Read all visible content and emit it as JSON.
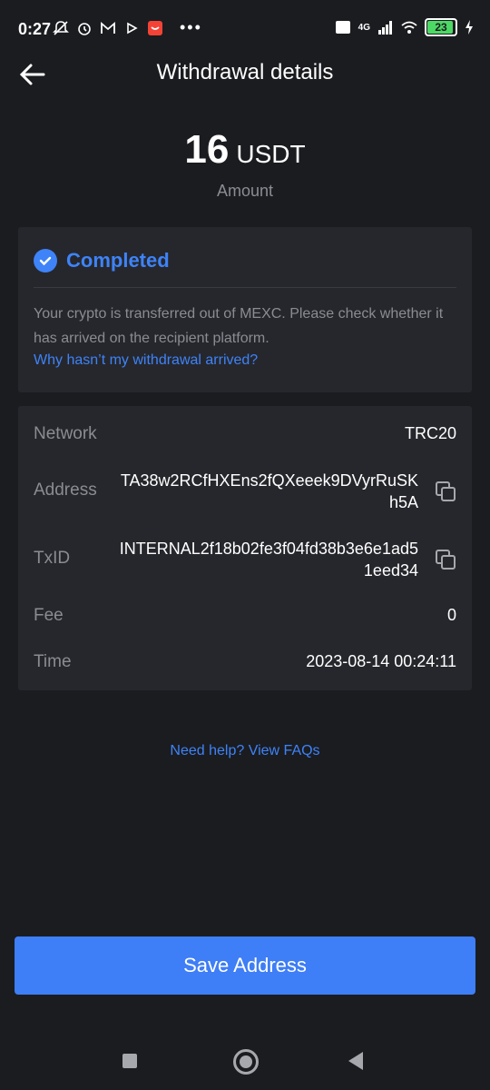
{
  "status_bar": {
    "time": "0:27",
    "network": "4G",
    "battery": "23"
  },
  "header": {
    "title": "Withdrawal details"
  },
  "amount": {
    "value": "16",
    "unit": "USDT",
    "label": "Amount"
  },
  "status": {
    "title": "Completed",
    "description": "Your crypto is transferred out of MEXC. Please check whether it has arrived on the recipient platform.",
    "link": "Why hasn’t my withdrawal arrived?"
  },
  "details": {
    "network": {
      "label": "Network",
      "value": "TRC20"
    },
    "address": {
      "label": "Address",
      "value": "TA38w2RCfHXEns2fQXeeek9DVyrRuSKh5A"
    },
    "txid": {
      "label": "TxID",
      "value": "INTERNAL2f18b02fe3f04fd38b3e6e1ad51eed34"
    },
    "fee": {
      "label": "Fee",
      "value": "0"
    },
    "time": {
      "label": "Time",
      "value": "2023-08-14 00:24:11"
    }
  },
  "faq_link": "Need help? View FAQs",
  "save_button": "Save Address",
  "colors": {
    "accent": "#3e83f8",
    "background": "#1b1c20",
    "card": "#26272c"
  }
}
